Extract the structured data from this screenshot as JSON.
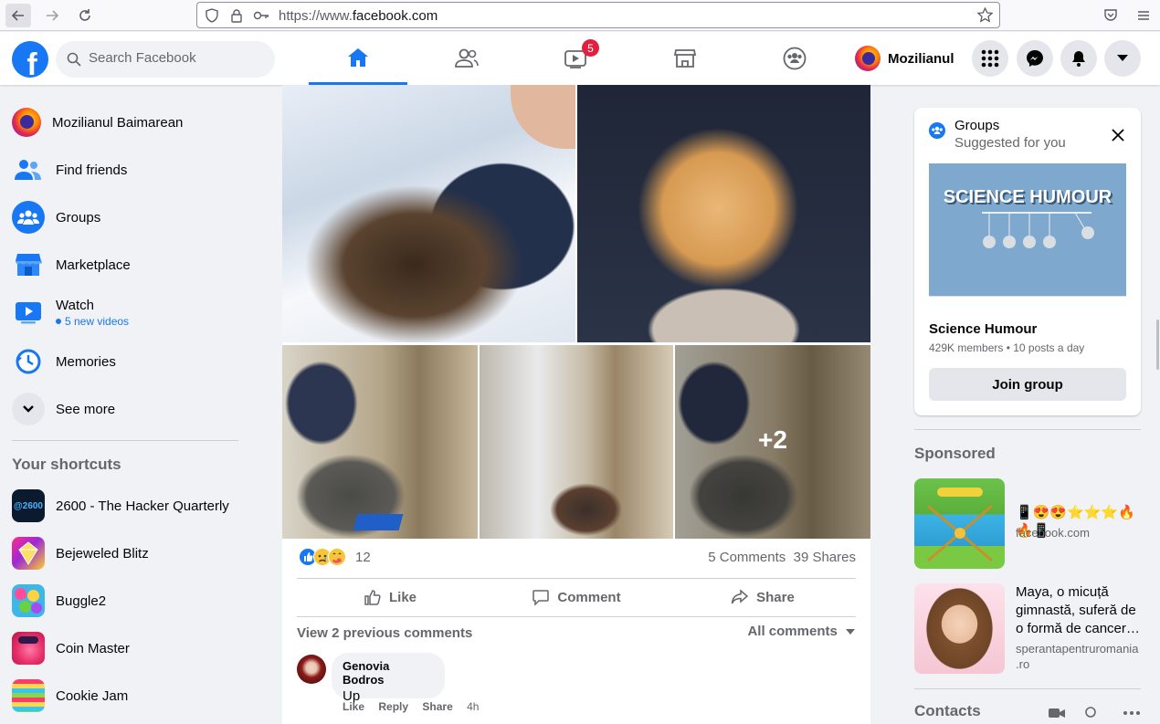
{
  "browser": {
    "url_prefix": "https://www.",
    "url_domain": "facebook.com",
    "icons": [
      "back-icon",
      "forward-icon",
      "reload-icon",
      "shield-icon",
      "lock-icon",
      "key-icon",
      "star-icon",
      "pocket-icon",
      "menu-icon"
    ]
  },
  "header": {
    "search_placeholder": "Search Facebook",
    "watch_badge": "5",
    "profile_name": "Mozilianul",
    "tabs": [
      "home",
      "friends",
      "watch",
      "marketplace",
      "groups"
    ]
  },
  "left_nav": {
    "items": [
      {
        "label": "Mozilianul Baimarean"
      },
      {
        "label": "Find friends"
      },
      {
        "label": "Groups"
      },
      {
        "label": "Marketplace"
      },
      {
        "label": "Watch",
        "sub": "5 new videos"
      },
      {
        "label": "Memories"
      },
      {
        "label": "See more"
      }
    ],
    "shortcuts_heading": "Your shortcuts",
    "shortcuts": [
      {
        "label": "2600 - The Hacker Quarterly"
      },
      {
        "label": "Bejeweled Blitz"
      },
      {
        "label": "Buggle2"
      },
      {
        "label": "Coin Master"
      },
      {
        "label": "Cookie Jam"
      }
    ]
  },
  "post": {
    "photos_more": "+2",
    "reaction_count": "12",
    "comments_label": "5 Comments",
    "shares_label": "39 Shares",
    "like_label": "Like",
    "comment_label": "Comment",
    "share_label": "Share",
    "prev_comments": "View 2 previous comments",
    "all_comments": "All comments",
    "comment": {
      "author": "Genovia Bodros",
      "text": "Up",
      "like": "Like",
      "reply": "Reply",
      "share": "Share",
      "time": "4h"
    }
  },
  "groups_card": {
    "title": "Groups",
    "subtitle": "Suggested for you",
    "banner_text": "SCIENCE HUMOUR",
    "group_name": "Science Humour",
    "group_meta": "429K members • 10 posts a day",
    "join_label": "Join group"
  },
  "sponsored": {
    "heading": "Sponsored",
    "ads": [
      {
        "text": "📱😍😍⭐⭐⭐🔥🔥📱",
        "site": "facebook.com"
      },
      {
        "text": "Maya, o micuță gimnastă, suferă de o formă de cancer…",
        "site_line1": "sperantapentruromania",
        "site_line2": ".ro"
      }
    ]
  },
  "contacts": {
    "heading": "Contacts"
  }
}
